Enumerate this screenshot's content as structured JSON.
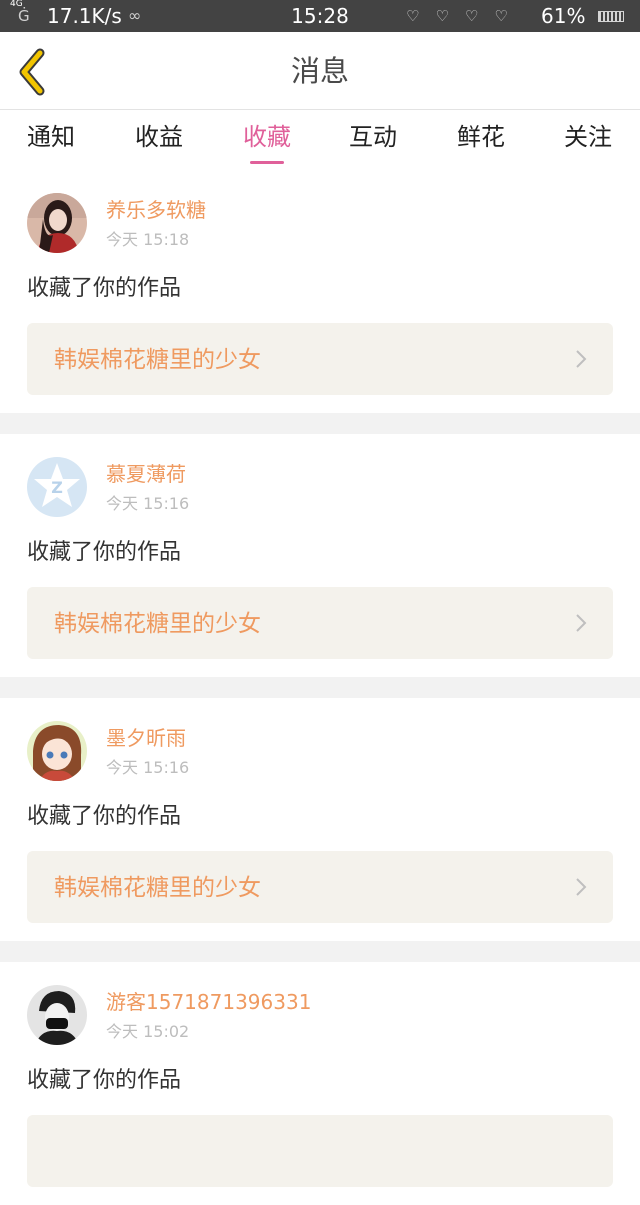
{
  "status_bar": {
    "network": "4G",
    "speed": "17.1K/s",
    "time": "15:28",
    "battery": "61%"
  },
  "nav": {
    "title": "消息"
  },
  "tabs": [
    {
      "label": "通知",
      "active": false
    },
    {
      "label": "收益",
      "active": false
    },
    {
      "label": "收藏",
      "active": true
    },
    {
      "label": "互动",
      "active": false
    },
    {
      "label": "鲜花",
      "active": false
    },
    {
      "label": "关注",
      "active": false
    }
  ],
  "messages": [
    {
      "user": "养乐多软糖",
      "time": "今天 15:18",
      "action": "收藏了你的作品",
      "work": "韩娱棉花糖里的少女",
      "avatar": "photo-avatar"
    },
    {
      "user": "慕夏薄荷",
      "time": "今天 15:16",
      "action": "收藏了你的作品",
      "work": "韩娱棉花糖里的少女",
      "avatar": "default-qzone-avatar"
    },
    {
      "user": "墨夕昕雨",
      "time": "今天 15:16",
      "action": "收藏了你的作品",
      "work": "韩娱棉花糖里的少女",
      "avatar": "anime-girl-avatar"
    },
    {
      "user": "游客1571871396331",
      "time": "今天 15:02",
      "action": "收藏了你的作品",
      "work": "",
      "avatar": "masked-person-avatar"
    }
  ],
  "colors": {
    "accent": "#e0609a",
    "username": "#ef9a60",
    "status_bar": "#434343",
    "back_arrow": "#f2c500"
  }
}
